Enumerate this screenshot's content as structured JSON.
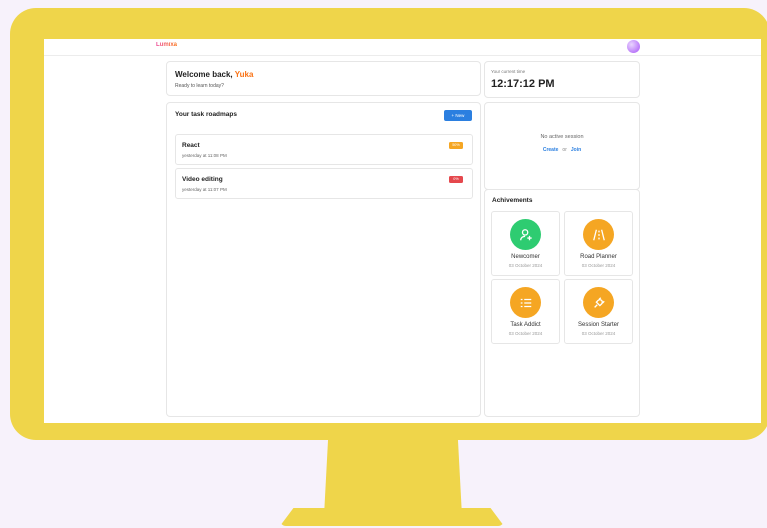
{
  "app": {
    "logo": "Lumixa"
  },
  "welcome": {
    "prefix": "Welcome back, ",
    "name": "Yuka",
    "subtitle": "Ready to learn today?"
  },
  "clock": {
    "label": "Your current time",
    "time": "12:17:12 PM"
  },
  "roadmaps": {
    "title": "Your task roadmaps",
    "new_label": "+ New",
    "items": [
      {
        "name": "React",
        "date": "yesterday at 11:08 PM",
        "progress": "50%",
        "badge_color": "#f5a623"
      },
      {
        "name": "Video editing",
        "date": "yesterday at 11:07 PM",
        "progress": "0%",
        "badge_color": "#e5484d"
      }
    ]
  },
  "session": {
    "message": "No active session",
    "create_label": "Create",
    "or_label": "or",
    "join_label": "Join"
  },
  "achievements": {
    "title": "Achivements",
    "items": [
      {
        "name": "Newcomer",
        "date": "03 October 2024",
        "icon": "user-plus-icon",
        "color": "#2ecc71"
      },
      {
        "name": "Road Planner",
        "date": "03 October 2024",
        "icon": "road-icon",
        "color": "#f5a623"
      },
      {
        "name": "Task Addict",
        "date": "03 October 2024",
        "icon": "list-icon",
        "color": "#f5a623"
      },
      {
        "name": "Session Starter",
        "date": "03 October 2024",
        "icon": "plug-icon",
        "color": "#f5a623"
      }
    ]
  }
}
